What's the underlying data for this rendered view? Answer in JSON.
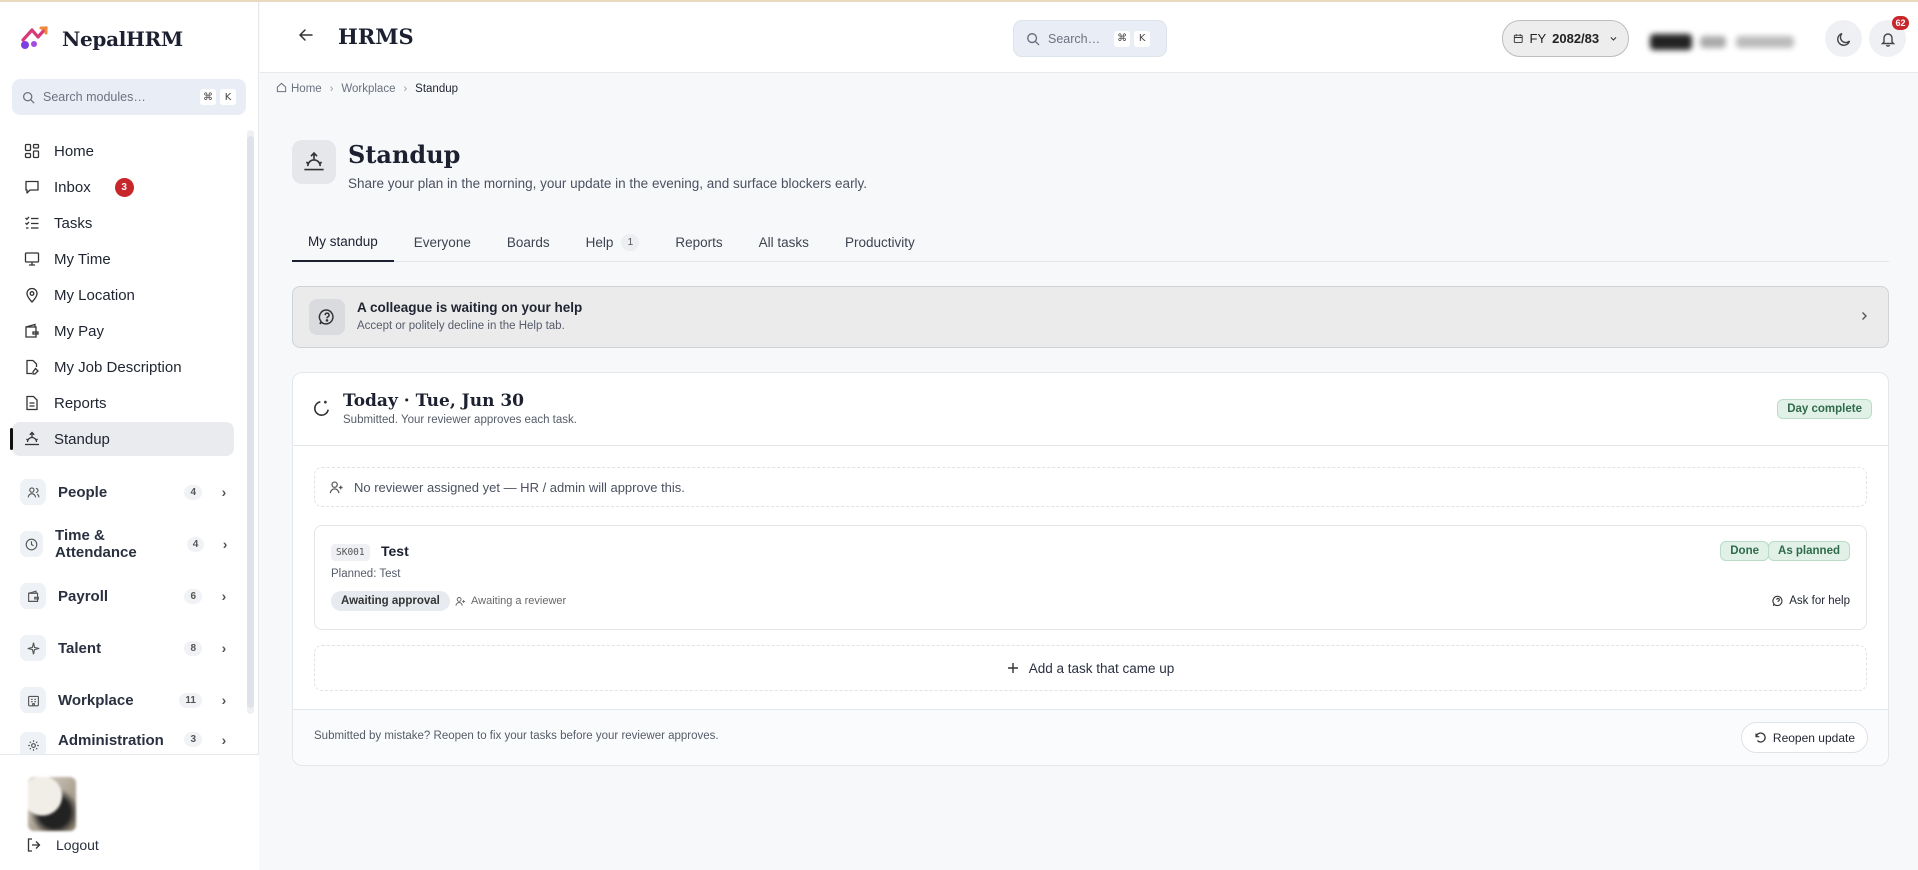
{
  "brand": {
    "name": "NepalHRM"
  },
  "sidebar": {
    "search": {
      "placeholder": "Search modules…",
      "kbd1": "⌘",
      "kbd2": "K"
    },
    "items": [
      {
        "label": "Home",
        "icon": "grid-icon"
      },
      {
        "label": "Inbox",
        "icon": "message-icon",
        "badge": "3"
      },
      {
        "label": "Tasks",
        "icon": "list-check-icon"
      },
      {
        "label": "My Time",
        "icon": "monitor-icon"
      },
      {
        "label": "My Location",
        "icon": "map-pin-icon"
      },
      {
        "label": "My Pay",
        "icon": "wallet-icon"
      },
      {
        "label": "My Job Description",
        "icon": "file-edit-icon"
      },
      {
        "label": "Reports",
        "icon": "document-icon"
      },
      {
        "label": "Standup",
        "icon": "sunrise-icon",
        "active": true
      }
    ],
    "groups": [
      {
        "label": "People",
        "count": "4",
        "icon": "users-icon"
      },
      {
        "label": "Time & Attendance",
        "count": "4",
        "icon": "clock-icon"
      },
      {
        "label": "Payroll",
        "count": "6",
        "icon": "wallet-icon"
      },
      {
        "label": "Talent",
        "count": "8",
        "icon": "sparkle-icon"
      },
      {
        "label": "Workplace",
        "count": "11",
        "icon": "building-icon"
      },
      {
        "label": "Administration",
        "count": "3",
        "icon": "gear-icon"
      }
    ],
    "logout": "Logout"
  },
  "header": {
    "title": "HRMS",
    "search": {
      "placeholder": "Search…",
      "kbd1": "⌘",
      "kbd2": "K"
    },
    "fy_prefix": "FY",
    "fy_value": "2082/83",
    "notifications": "62"
  },
  "breadcrumb": {
    "home": "Home",
    "parent": "Workplace",
    "current": "Standup"
  },
  "page": {
    "title": "Standup",
    "subtitle": "Share your plan in the morning, your update in the evening, and surface blockers early."
  },
  "tabs": [
    {
      "label": "My standup",
      "active": true
    },
    {
      "label": "Everyone"
    },
    {
      "label": "Boards"
    },
    {
      "label": "Help",
      "count": "1"
    },
    {
      "label": "Reports"
    },
    {
      "label": "All tasks"
    },
    {
      "label": "Productivity"
    }
  ],
  "banner": {
    "title": "A colleague is waiting on your help",
    "subtitle": "Accept or politely decline in the Help tab."
  },
  "today": {
    "title": "Today · Tue, Jun 30",
    "subtitle": "Submitted. Your reviewer approves each task.",
    "status": "Day complete",
    "reviewer_note": "No reviewer assigned yet — HR / admin will approve this.",
    "task": {
      "code": "SK001",
      "name": "Test",
      "planned": "Planned: Test",
      "status1": "Done",
      "status2": "As planned",
      "approval": "Awaiting approval",
      "awaiting": "Awaiting a reviewer",
      "ask_help": "Ask for help"
    },
    "add_task": "Add a task that came up",
    "footer_note": "Submitted by mistake? Reopen to fix your tasks before your reviewer approves.",
    "reopen": "Reopen update"
  },
  "colors": {
    "accent": "#1c2030",
    "badge": "#c7262a",
    "success": "#2f6a4a"
  }
}
